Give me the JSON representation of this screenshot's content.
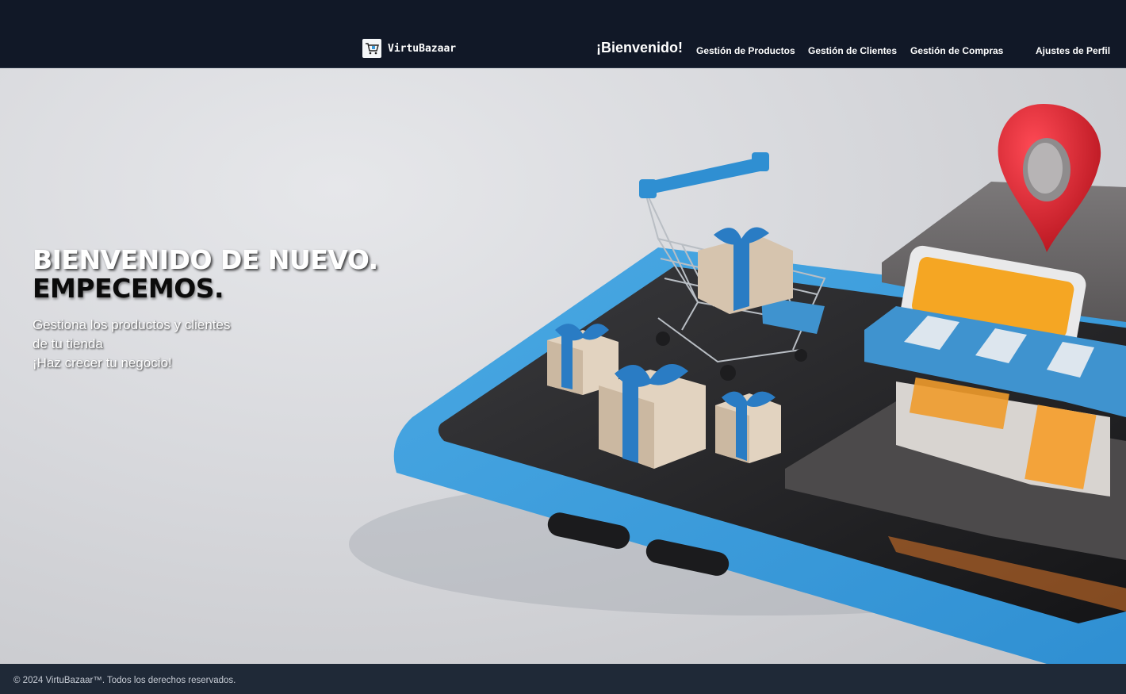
{
  "brand": {
    "name": "VirtuBazaar",
    "logo_icon": "shopping-cart-icon"
  },
  "nav": {
    "welcome": "¡Bienvenido!",
    "links": [
      "Gestión de Productos",
      "Gestión de Clientes",
      "Gestión de Compras",
      "Ajustes de Perfil"
    ]
  },
  "hero": {
    "title_line1": "BIENVENIDO DE NUEVO.",
    "title_line2": "EMPECEMOS.",
    "subtitle_lines": [
      "Gestiona los productos y clientes",
      "de tu tienda",
      "¡Haz crecer tu negocio!"
    ]
  },
  "footer": {
    "copyright": "© 2024 VirtuBazaar™. Todos los derechos reservados."
  },
  "colors": {
    "navbar": "#111827",
    "footer": "#1f2937",
    "accent_blue": "#3a9ad9",
    "pin_red": "#d81e2a"
  }
}
